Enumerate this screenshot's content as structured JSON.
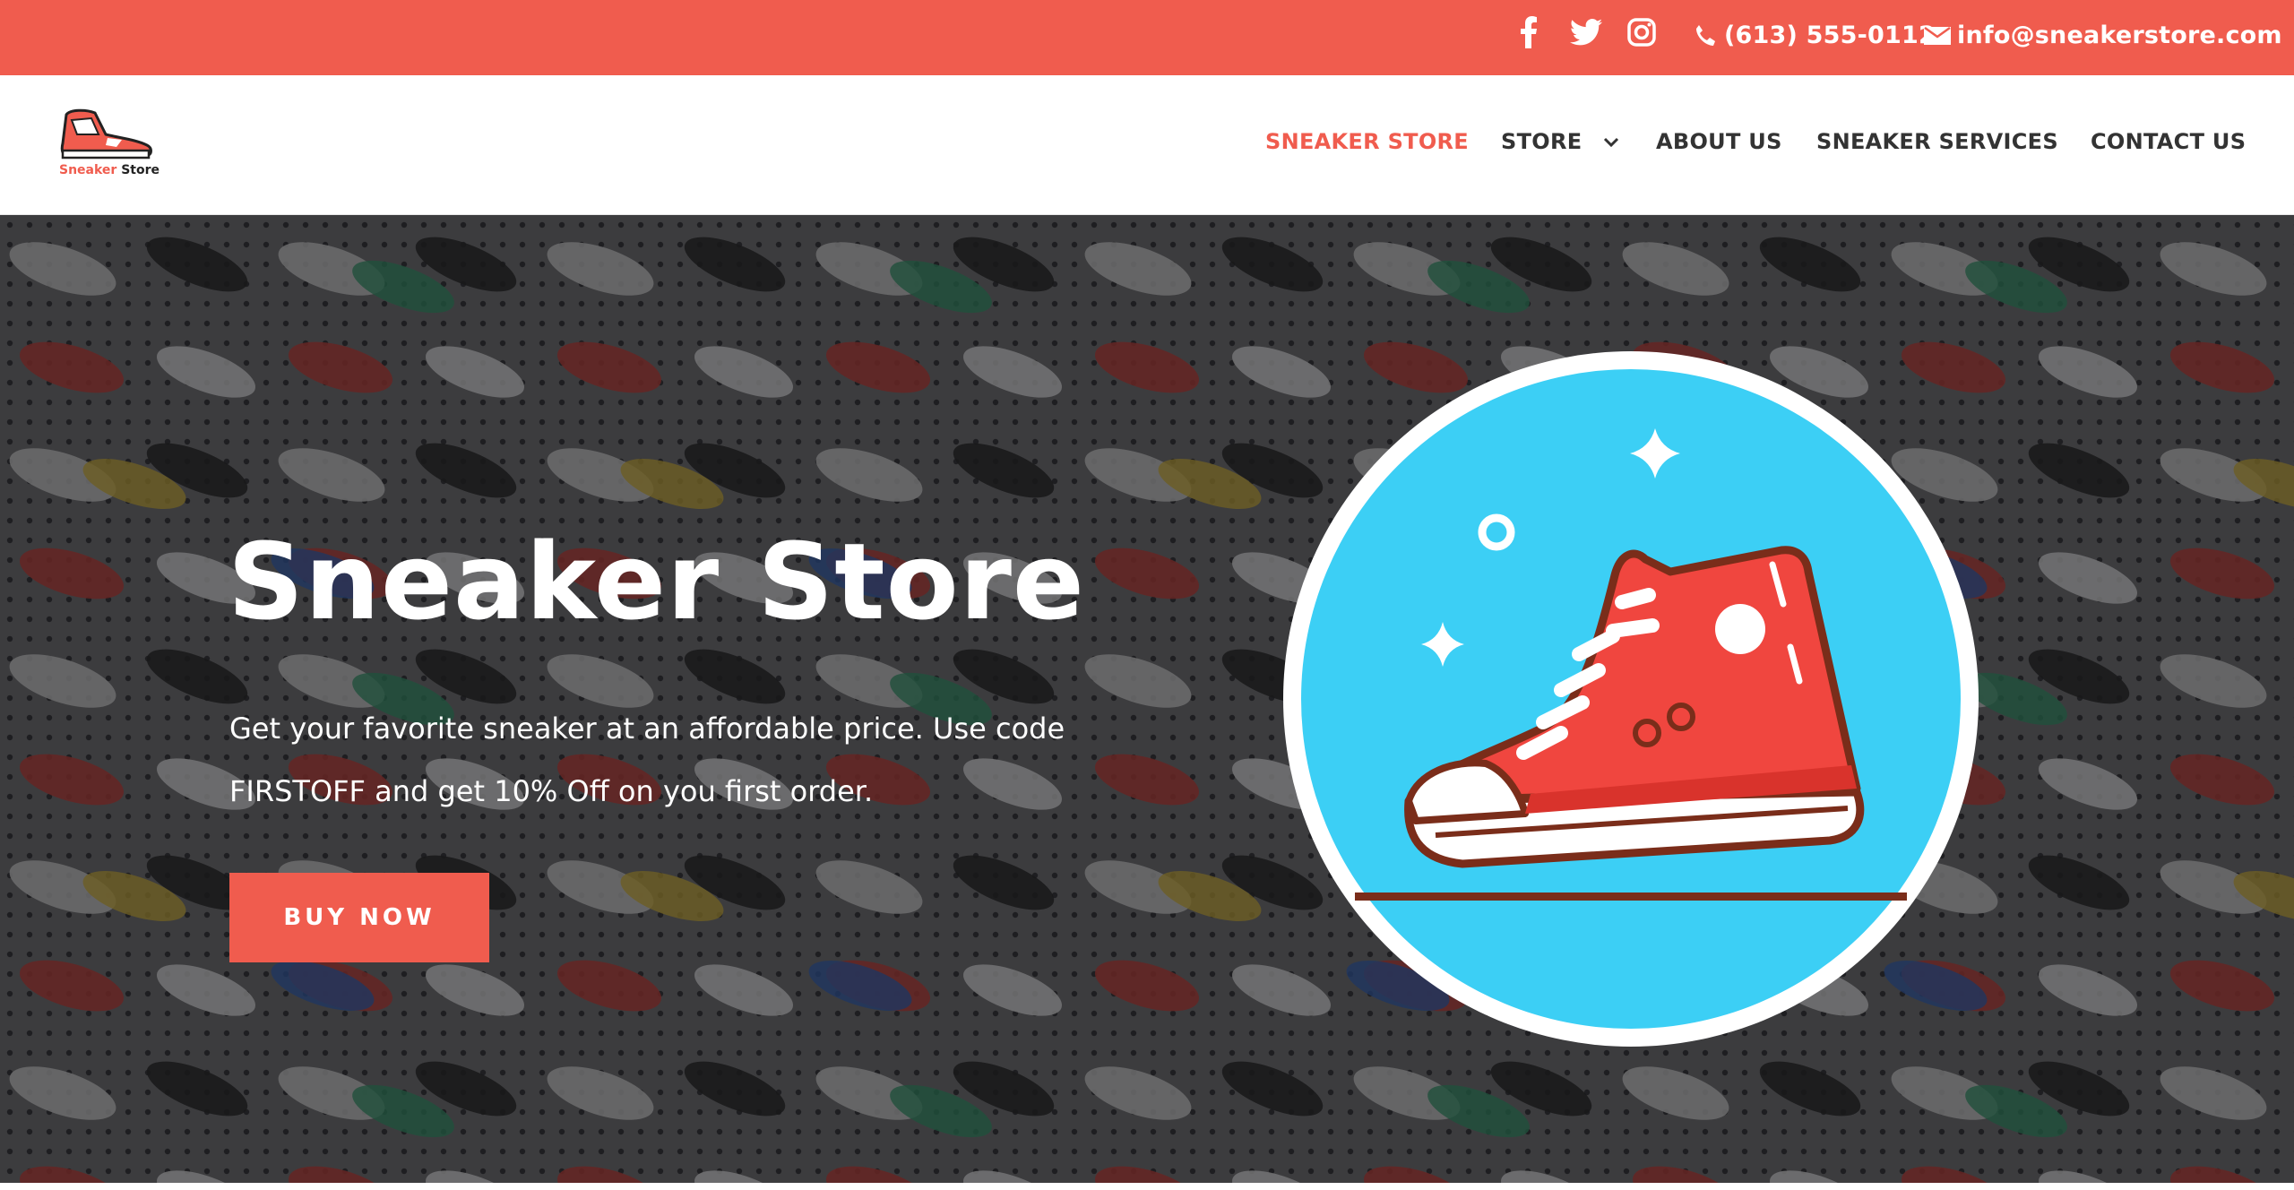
{
  "topbar": {
    "social": [
      "facebook-icon",
      "twitter-icon",
      "instagram-icon"
    ],
    "phone": "(613) 555-0112",
    "email": "info@sneakerstore.com",
    "colors": {
      "accent": "#f05c4e"
    }
  },
  "header": {
    "logo": {
      "text_a": "Sneaker",
      "text_b": "Store"
    },
    "nav": [
      {
        "label": "SNEAKER STORE",
        "active": true
      },
      {
        "label": "STORE",
        "has_dropdown": true
      },
      {
        "label": "ABOUT US"
      },
      {
        "label": "SNEAKER SERVICES"
      },
      {
        "label": "CONTACT US"
      }
    ]
  },
  "hero": {
    "title": "Sneaker Store",
    "text": "Get your favorite sneaker at an affordable price. Use code FIRSTOFF and get 10% Off on you first order.",
    "button": "BUY NOW",
    "illustration": "sneaker-illustration",
    "colors": {
      "circle": "#3ccff5",
      "shoe": "#f0463f",
      "outline": "#7a2d1a"
    }
  }
}
